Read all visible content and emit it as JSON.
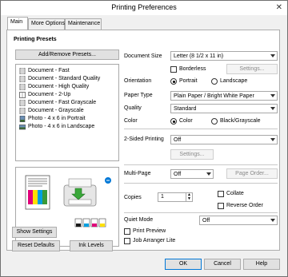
{
  "window": {
    "title": "Printing Preferences",
    "close_glyph": "✕"
  },
  "tabs": [
    {
      "label": "Main",
      "active": true
    },
    {
      "label": "More Options",
      "active": false
    },
    {
      "label": "Maintenance",
      "active": false
    }
  ],
  "presets": {
    "heading": "Printing Presets",
    "add_remove_label": "Add/Remove Presets...",
    "items": [
      {
        "label": "Document - Fast",
        "icon": "document-icon"
      },
      {
        "label": "Document - Standard Quality",
        "icon": "document-icon"
      },
      {
        "label": "Document - High Quality",
        "icon": "document-icon"
      },
      {
        "label": "Document - 2-Up",
        "icon": "document-2up-icon"
      },
      {
        "label": "Document - Fast Grayscale",
        "icon": "document-icon"
      },
      {
        "label": "Document - Grayscale",
        "icon": "document-icon"
      },
      {
        "label": "Photo - 4 x 6 in Portrait",
        "icon": "photo-icon"
      },
      {
        "label": "Photo - 4 x 6 in Landscape",
        "icon": "photo-icon"
      }
    ]
  },
  "document_size": {
    "label": "Document Size",
    "value": "Letter (8 1/2 x 11 in)"
  },
  "borderless": {
    "label": "Borderless",
    "checked": false,
    "settings_label": "Settings..."
  },
  "orientation": {
    "label": "Orientation",
    "options": [
      "Portrait",
      "Landscape"
    ],
    "selected": "Portrait"
  },
  "paper_type": {
    "label": "Paper Type",
    "value": "Plain Paper / Bright White Paper"
  },
  "quality": {
    "label": "Quality",
    "value": "Standard"
  },
  "color": {
    "label": "Color",
    "options": [
      "Color",
      "Black/Grayscale"
    ],
    "selected": "Color"
  },
  "two_sided": {
    "label": "2-Sided Printing",
    "value": "Off",
    "settings_label": "Settings..."
  },
  "multi_page": {
    "label": "Multi-Page",
    "value": "Off",
    "page_order_label": "Page Order..."
  },
  "copies": {
    "label": "Copies",
    "value": "1",
    "collate_label": "Collate",
    "reverse_order_label": "Reverse Order"
  },
  "quiet_mode": {
    "label": "Quiet Mode",
    "value": "Off"
  },
  "print_preview": {
    "label": "Print Preview"
  },
  "job_arranger": {
    "label": "Job Arranger Lite"
  },
  "left_buttons": {
    "show_settings": "Show Settings",
    "reset_defaults": "Reset Defaults",
    "ink_levels": "Ink Levels"
  },
  "footer": {
    "ok": "OK",
    "cancel": "Cancel",
    "help": "Help"
  },
  "colors": {
    "accent": "#0078d7",
    "ink_black": "#1a1a1a",
    "ink_cyan": "#00a0e0",
    "ink_magenta": "#e0007a",
    "ink_yellow": "#ffe000"
  }
}
